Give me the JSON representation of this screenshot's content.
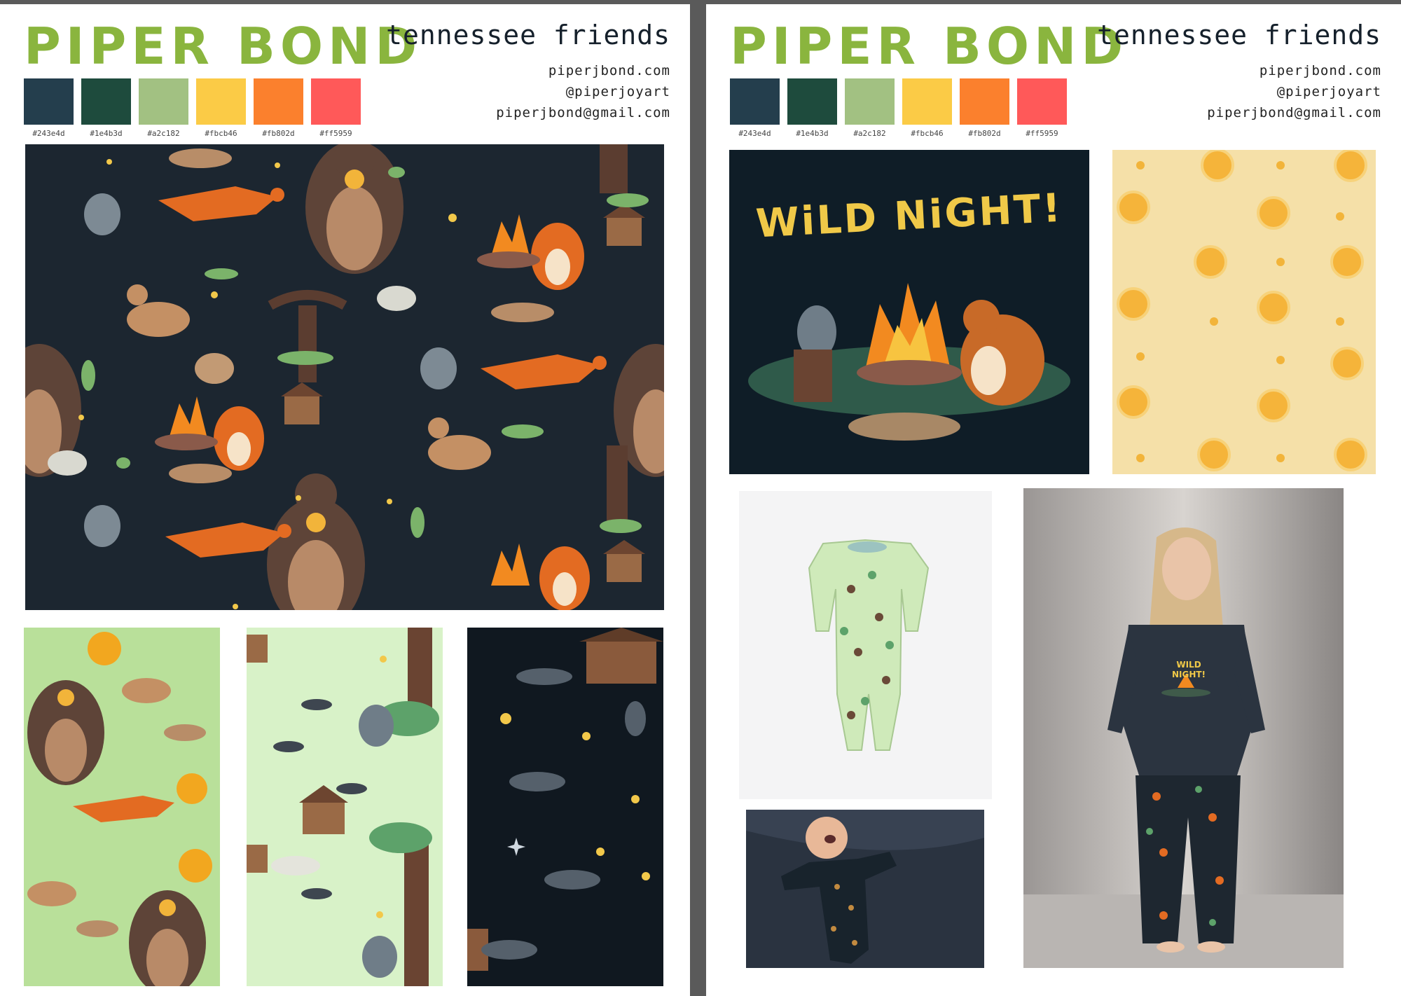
{
  "brand": {
    "name": "PIPER BOND",
    "collection": "tennessee friends"
  },
  "contact": {
    "website": "piperjbond.com",
    "handle": "@piperjoyart",
    "email": "piperjbond@gmail.com"
  },
  "palette": [
    {
      "hex": "#243e4d",
      "color": "#243e4d"
    },
    {
      "hex": "#1e4b3d",
      "color": "#1e4b3d"
    },
    {
      "hex": "#a2c182",
      "color": "#a2c182"
    },
    {
      "hex": "#fbcb46",
      "color": "#fbcb46"
    },
    {
      "hex": "#fb802d",
      "color": "#fb802d"
    },
    {
      "hex": "#ff5959",
      "color": "#ff5959"
    }
  ],
  "right_sheet": {
    "print_title": "WiLD NiGHT!",
    "shirt_print_title": "WILD NIGHT!"
  },
  "icons": {
    "main_pattern": [
      "bear-icon",
      "fox-icon",
      "deer-icon",
      "raccoon-icon",
      "campfire-icon",
      "birdhouse-icon",
      "owl-icon",
      "bat-icon",
      "tree-icon",
      "bobcat-icon"
    ],
    "mockups": [
      "onesie-mockup",
      "baby-photo",
      "girl-pajama-photo"
    ]
  }
}
